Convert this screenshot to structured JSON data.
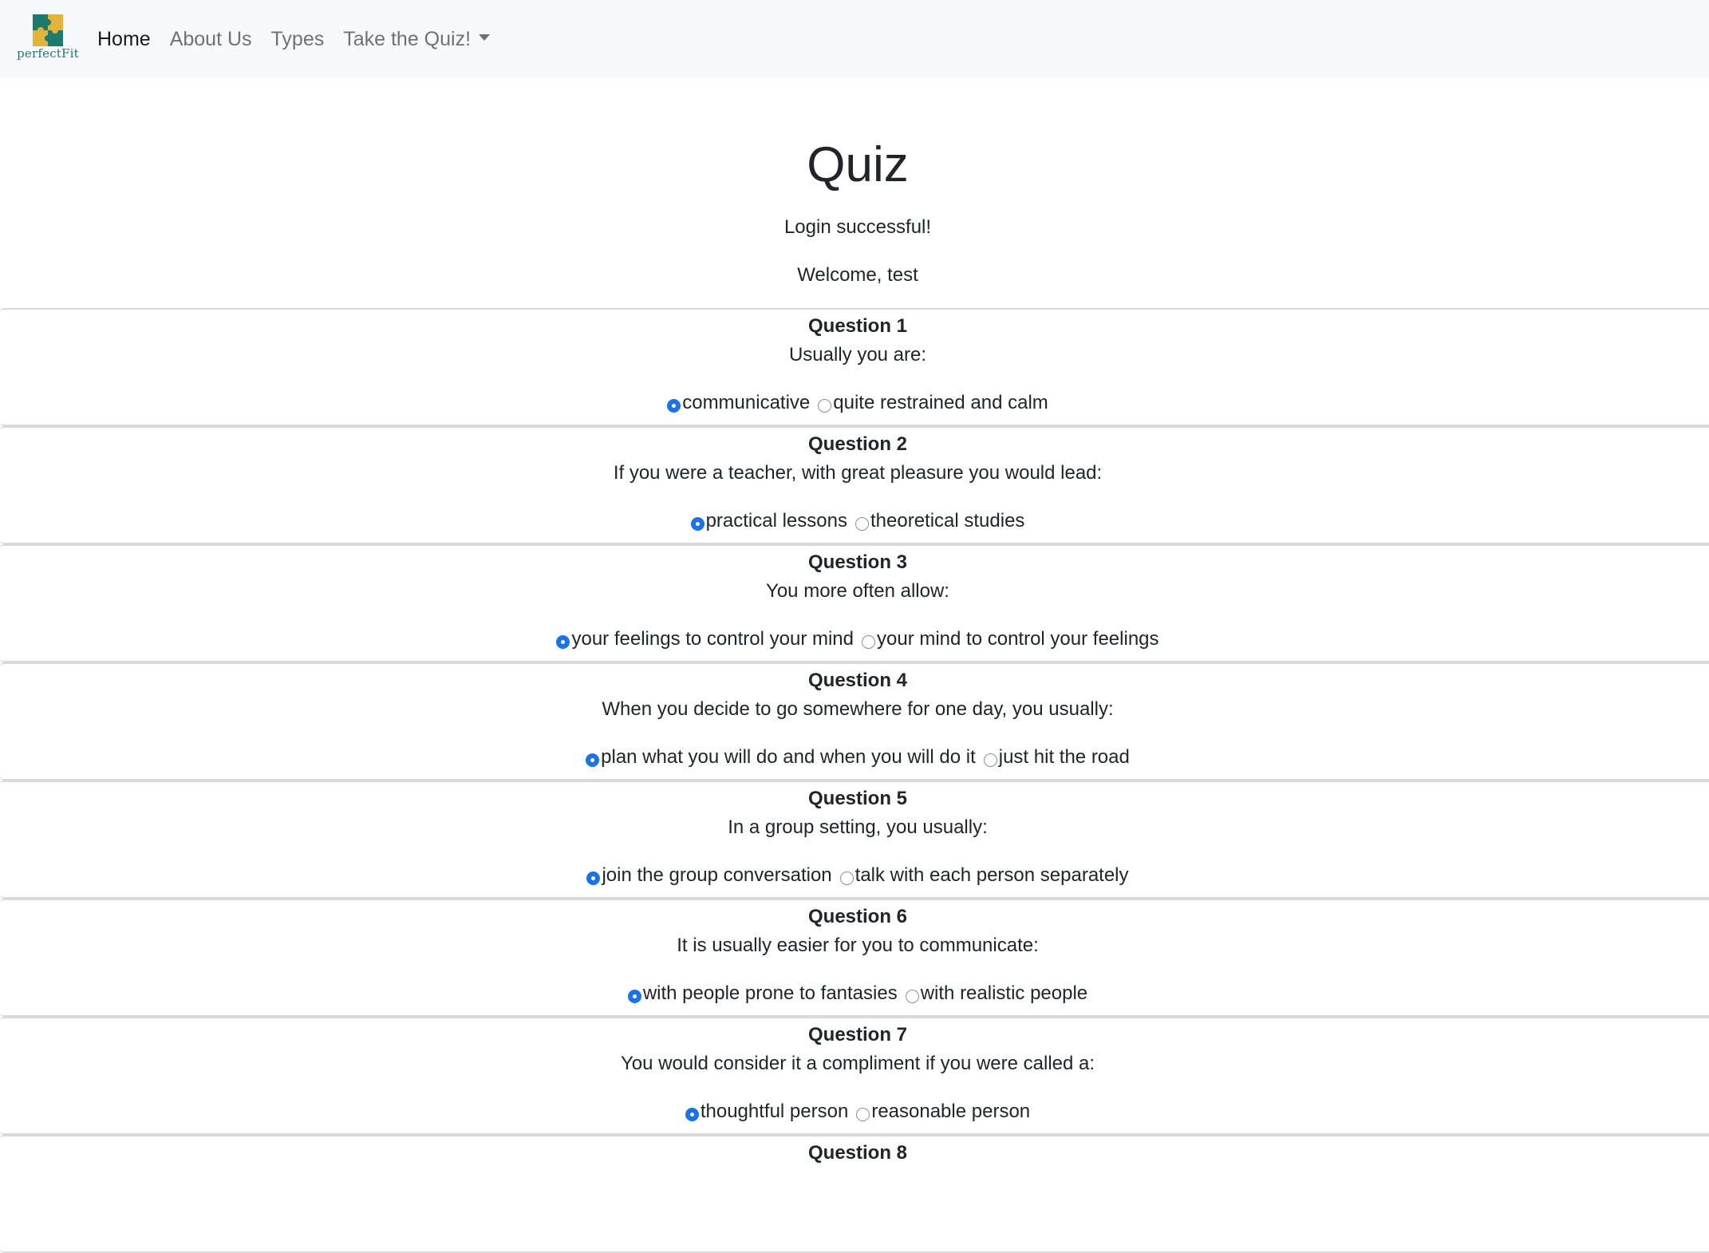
{
  "nav": {
    "brand_text": "perfectFit",
    "links": [
      {
        "label": "Home",
        "active": true
      },
      {
        "label": "About Us",
        "active": false
      },
      {
        "label": "Types",
        "active": false
      },
      {
        "label": "Take the Quiz!",
        "active": false,
        "dropdown": true
      }
    ]
  },
  "page": {
    "title": "Quiz",
    "login_message": "Login successful!",
    "welcome_message": "Welcome, test"
  },
  "colors": {
    "navbar_bg": "#f8f9fa",
    "radio_selected": "#1a73e8",
    "logo_teal": "#1f7a6e",
    "logo_gold": "#e2b43c"
  },
  "questions": [
    {
      "title": "Question 1",
      "text": "Usually you are:",
      "options": [
        "communicative",
        "quite restrained and calm"
      ],
      "selected": 0
    },
    {
      "title": "Question 2",
      "text": "If you were a teacher, with great pleasure you would lead:",
      "options": [
        "practical lessons",
        "theoretical studies"
      ],
      "selected": 0
    },
    {
      "title": "Question 3",
      "text": "You more often allow:",
      "options": [
        "your feelings to control your mind",
        "your mind to control your feelings"
      ],
      "selected": 0
    },
    {
      "title": "Question 4",
      "text": "When you decide to go somewhere for one day, you usually:",
      "options": [
        "plan what you will do and when you will do it",
        "just hit the road"
      ],
      "selected": 0
    },
    {
      "title": "Question 5",
      "text": "In a group setting, you usually:",
      "options": [
        "join the group conversation",
        "talk with each person separately"
      ],
      "selected": 0
    },
    {
      "title": "Question 6",
      "text": "It is usually easier for you to communicate:",
      "options": [
        "with people prone to fantasies",
        "with realistic people"
      ],
      "selected": 0
    },
    {
      "title": "Question 7",
      "text": "You would consider it a compliment if you were called a:",
      "options": [
        "thoughtful person",
        "reasonable person"
      ],
      "selected": 0
    },
    {
      "title": "Question 8",
      "text": "",
      "options": [],
      "selected": null
    }
  ]
}
